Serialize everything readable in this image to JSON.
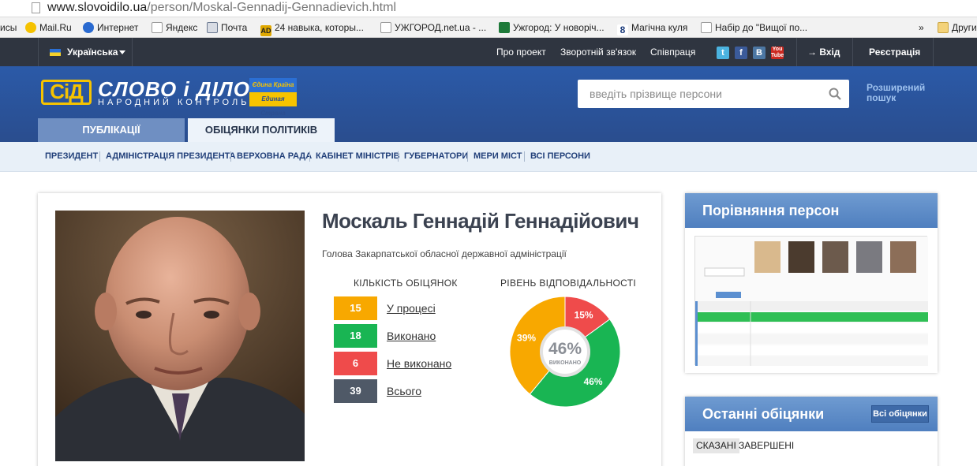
{
  "browser": {
    "url_domain": "www.slovoidilo.ua",
    "url_path": "/person/Moskal-Gennadij-Gennadievich.html",
    "bookmarks": [
      "исы",
      "Mail.Ru",
      "Интернет",
      "Яндекс",
      "Почта",
      "24 навыка, которы...",
      "УЖГОРОД.net.ua - ...",
      "Ужгород: У новоріч...",
      "Магічна куля",
      "Набір до \"Вищої по...",
      "»",
      "Другие"
    ]
  },
  "topbar": {
    "language": "Українська",
    "links": [
      "Про проект",
      "Зворотній зв'язок",
      "Співпраця"
    ],
    "login": "→ Вхід",
    "register": "Реєстрація",
    "social": [
      "twitter-icon",
      "facebook-icon",
      "vkontakte-icon",
      "youtube-icon"
    ]
  },
  "header": {
    "logo_mark": "СіД",
    "logo_title": "СЛОВО і ДІЛО",
    "logo_subtitle": "НАРОДНИЙ КОНТРОЛЬ",
    "badge_top": "Єдина Країна",
    "badge_bottom": "Единая Страна",
    "search_placeholder": "введіть прізвище персони",
    "advanced_search": [
      "Розширений",
      "пошук"
    ],
    "tabs": [
      "ПУБЛІКАЦІЇ",
      "ОБІЦЯНКИ ПОЛІТИКІВ"
    ]
  },
  "subnav": [
    "ПРЕЗИДЕНТ",
    "АДМІНІСТРАЦІЯ ПРЕЗИДЕНТА",
    "ВЕРХОВНА РАДА",
    "КАБІНЕТ МІНІСТРІВ",
    "ГУБЕРНАТОРИ",
    "МЕРИ МІСТ",
    "ВСІ ПЕРСОНИ"
  ],
  "person": {
    "name": "Москаль Геннадій Геннадійович",
    "role": "Голова Закарпатської обласної державної адміністрації",
    "count_title": "КІЛЬКІСТЬ ОБІЦЯНОК",
    "responsibility_title": "РІВЕНЬ ВІДПОВІДАЛЬНОСТІ",
    "stats": [
      {
        "value": "15",
        "label": "У процесі",
        "color": "#f8a800"
      },
      {
        "value": "18",
        "label": "Виконано",
        "color": "#19b553"
      },
      {
        "value": "6",
        "label": "Не виконано",
        "color": "#ef4b4b"
      },
      {
        "value": "39",
        "label": "Всього",
        "color": "#4f5967"
      }
    ]
  },
  "chart_data": {
    "type": "pie",
    "center_value": "46%",
    "center_label": "ВИКОНАНО",
    "slices": [
      {
        "label": "15%",
        "value": 15,
        "color": "#ef4b4b"
      },
      {
        "label": "46%",
        "value": 46,
        "color": "#19b553"
      },
      {
        "label": "39%",
        "value": 39,
        "color": "#f8a800"
      }
    ]
  },
  "widgets": {
    "compare_title": "Порівняння персон",
    "recent_title": "Останні обіцянки",
    "all_promises": "Всі обіцянки",
    "filters": [
      "СКАЗАНІ",
      "ЗАВЕРШЕНІ"
    ]
  }
}
